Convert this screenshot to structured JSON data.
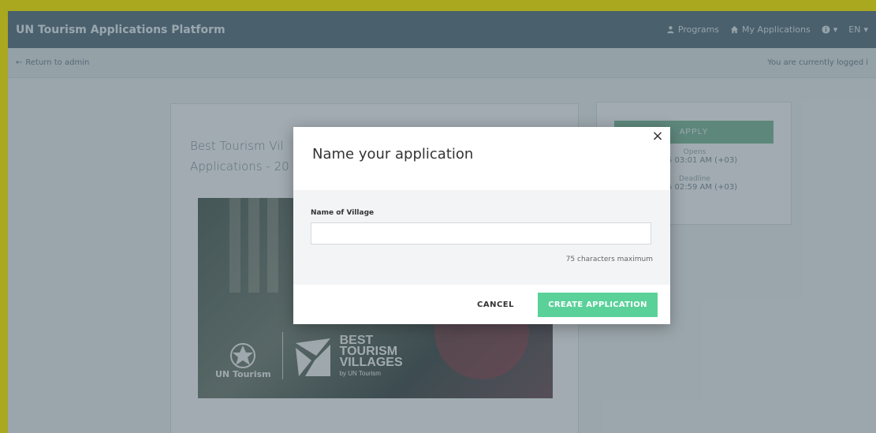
{
  "app": {
    "title": "UN Tourism Applications Platform",
    "nav": {
      "programs": "Programs",
      "my_applications": "My Applications",
      "help_caret": "▾",
      "language": "EN",
      "language_caret": "▾"
    },
    "colors": {
      "topbar": "#566d7d",
      "frame": "#a9a81e",
      "accent_green": "#5bd19a"
    }
  },
  "subbar": {
    "return_label": "Return to admin",
    "logged_in_text": "You are currently logged i"
  },
  "program": {
    "title_line1": "Best Tourism Vil",
    "title_line2": "Applications - 20",
    "hero_logo_left": "UN Tourism",
    "hero_logo_right": [
      "BEST",
      "TOURISM",
      "VILLAGES"
    ],
    "hero_logo_by": "by UN Tourism"
  },
  "sidebar": {
    "apply_label": "APPLY",
    "opens_label": "Opens",
    "opens_value": "2025 03:01 AM (+03)",
    "deadline_label": "Deadline",
    "deadline_value": "2025 02:59 AM (+03)"
  },
  "modal": {
    "title": "Name your application",
    "field_label": "Name of Village",
    "field_value": "",
    "field_placeholder": "",
    "char_hint": "75 characters maximum",
    "cancel_label": "CANCEL",
    "create_label": "CREATE APPLICATION",
    "close_glyph": "×"
  }
}
